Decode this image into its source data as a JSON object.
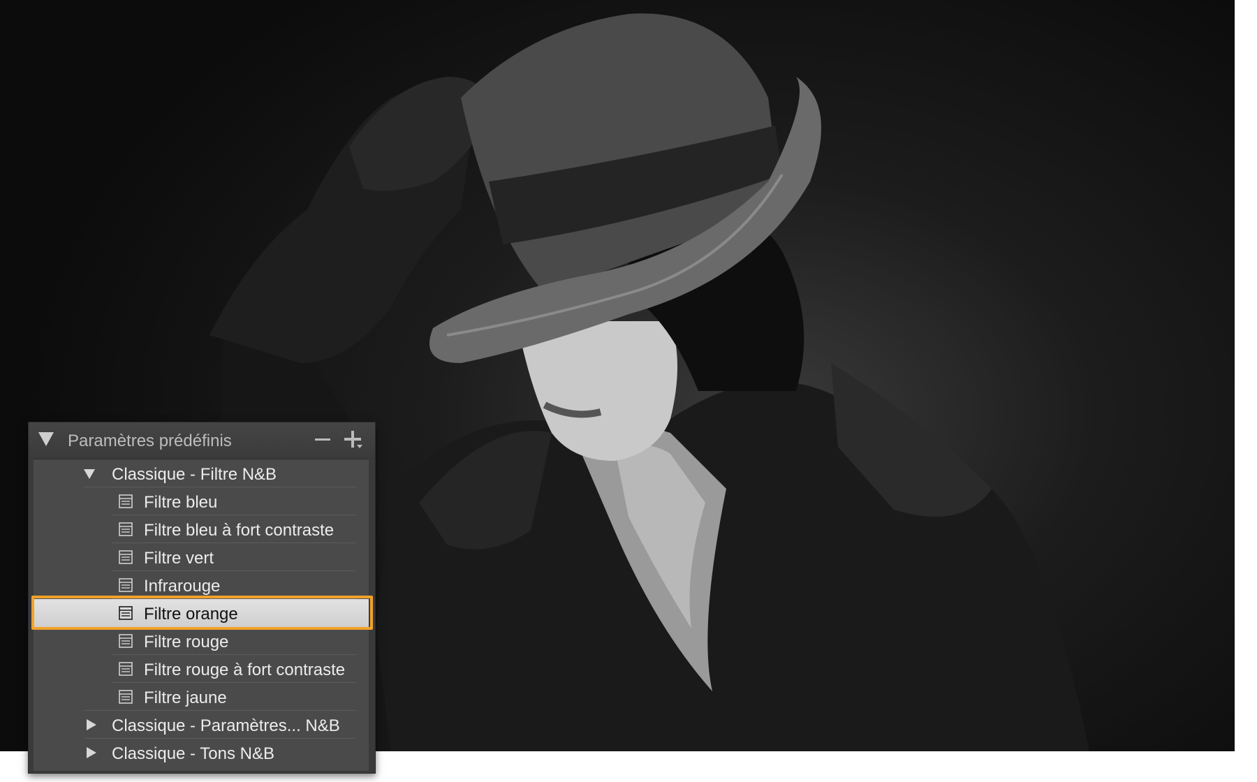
{
  "presets_panel": {
    "title": "Paramètres prédéfinis",
    "collapse_icon": "triangle-down-icon",
    "remove_icon": "minus-icon",
    "add_icon": "plus-dropdown-icon",
    "groups": [
      {
        "label": "Classique - Filtre N&B",
        "expanded": true,
        "items": [
          {
            "label": "Filtre bleu",
            "selected": false
          },
          {
            "label": "Filtre bleu à fort contraste",
            "selected": false
          },
          {
            "label": "Filtre vert",
            "selected": false
          },
          {
            "label": "Infrarouge",
            "selected": false
          },
          {
            "label": "Filtre orange",
            "selected": true
          },
          {
            "label": "Filtre rouge",
            "selected": false
          },
          {
            "label": "Filtre rouge à fort contraste",
            "selected": false
          },
          {
            "label": "Filtre jaune",
            "selected": false
          }
        ]
      },
      {
        "label": "Classique - Paramètres... N&B",
        "expanded": false
      },
      {
        "label": "Classique - Tons N&B",
        "expanded": false
      }
    ]
  },
  "colors": {
    "highlight_outline": "#f0a22a",
    "panel_background": "#4a4a4a",
    "selected_row": "#d8d8d8"
  }
}
